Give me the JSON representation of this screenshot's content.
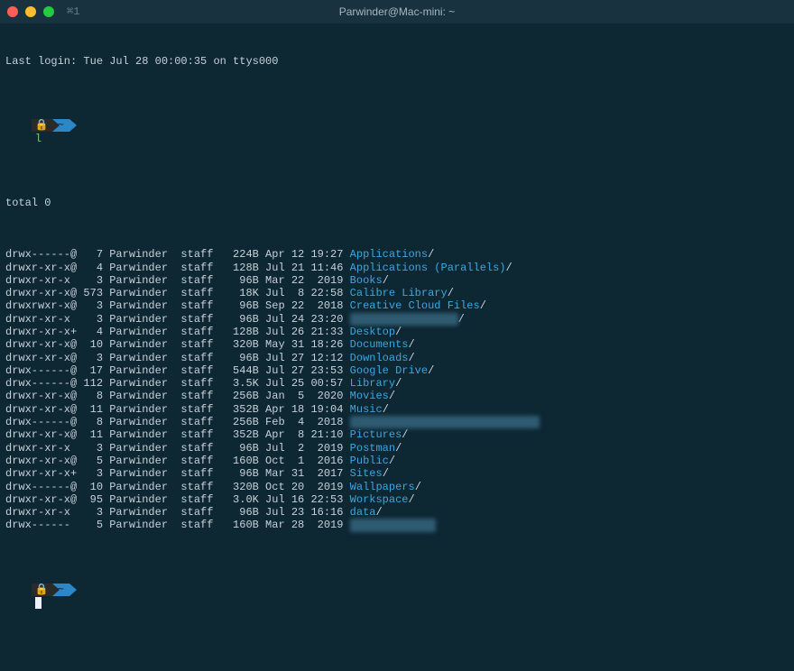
{
  "window": {
    "title": "Parwinder@Mac-mini: ~",
    "shortcut": "⌘1"
  },
  "last_login": "Last login: Tue Jul 28 00:00:35 on ttys000",
  "prompt": {
    "lock_glyph": "",
    "path": "~",
    "command": "l"
  },
  "total_line": "total 0",
  "listing": [
    {
      "perm": "drwx------@",
      "links": "7",
      "owner": "Parwinder",
      "group": "staff",
      "size": "224B",
      "date": "Apr 12 19:27",
      "name": "Applications",
      "suffix": "/",
      "blurred": false
    },
    {
      "perm": "drwxr-xr-x@",
      "links": "4",
      "owner": "Parwinder",
      "group": "staff",
      "size": "128B",
      "date": "Jul 21 11:46",
      "name": "Applications (Parallels)",
      "suffix": "/",
      "blurred": false
    },
    {
      "perm": "drwxr-xr-x ",
      "links": "3",
      "owner": "Parwinder",
      "group": "staff",
      "size": "96B",
      "date": "Mar 22  2019",
      "name": "Books",
      "suffix": "/",
      "blurred": false
    },
    {
      "perm": "drwxr-xr-x@",
      "links": "573",
      "owner": "Parwinder",
      "group": "staff",
      "size": "18K",
      "date": "Jul  8 22:58",
      "name": "Calibre Library",
      "suffix": "/",
      "blurred": false
    },
    {
      "perm": "drwxrwxr-x@",
      "links": "3",
      "owner": "Parwinder",
      "group": "staff",
      "size": "96B",
      "date": "Sep 22  2018",
      "name": "Creative Cloud Files",
      "suffix": "/",
      "blurred": false
    },
    {
      "perm": "drwxr-xr-x ",
      "links": "3",
      "owner": "Parwinder",
      "group": "staff",
      "size": "96B",
      "date": "Jul 24 23:20",
      "name": "",
      "suffix": "/",
      "blurred": true,
      "blurwidth": 120
    },
    {
      "perm": "drwxr-xr-x+",
      "links": "4",
      "owner": "Parwinder",
      "group": "staff",
      "size": "128B",
      "date": "Jul 26 21:33",
      "name": "Desktop",
      "suffix": "/",
      "blurred": false
    },
    {
      "perm": "drwxr-xr-x@",
      "links": "10",
      "owner": "Parwinder",
      "group": "staff",
      "size": "320B",
      "date": "May 31 18:26",
      "name": "Documents",
      "suffix": "/",
      "blurred": false
    },
    {
      "perm": "drwxr-xr-x@",
      "links": "3",
      "owner": "Parwinder",
      "group": "staff",
      "size": "96B",
      "date": "Jul 27 12:12",
      "name": "Downloads",
      "suffix": "/",
      "blurred": false
    },
    {
      "perm": "drwx------@",
      "links": "17",
      "owner": "Parwinder",
      "group": "staff",
      "size": "544B",
      "date": "Jul 27 23:53",
      "name": "Google Drive",
      "suffix": "/",
      "blurred": false
    },
    {
      "perm": "drwx------@",
      "links": "112",
      "owner": "Parwinder",
      "group": "staff",
      "size": "3.5K",
      "date": "Jul 25 00:57",
      "name": "Library",
      "suffix": "/",
      "blurred": false
    },
    {
      "perm": "drwxr-xr-x@",
      "links": "8",
      "owner": "Parwinder",
      "group": "staff",
      "size": "256B",
      "date": "Jan  5  2020",
      "name": "Movies",
      "suffix": "/",
      "blurred": false
    },
    {
      "perm": "drwxr-xr-x@",
      "links": "11",
      "owner": "Parwinder",
      "group": "staff",
      "size": "352B",
      "date": "Apr 18 19:04",
      "name": "Music",
      "suffix": "/",
      "blurred": false
    },
    {
      "perm": "drwx------@",
      "links": "8",
      "owner": "Parwinder",
      "group": "staff",
      "size": "256B",
      "date": "Feb  4  2018",
      "name": "",
      "suffix": "",
      "blurred": true,
      "blurwidth": 210
    },
    {
      "perm": "drwxr-xr-x@",
      "links": "11",
      "owner": "Parwinder",
      "group": "staff",
      "size": "352B",
      "date": "Apr  8 21:10",
      "name": "Pictures",
      "suffix": "/",
      "blurred": false
    },
    {
      "perm": "drwxr-xr-x ",
      "links": "3",
      "owner": "Parwinder",
      "group": "staff",
      "size": "96B",
      "date": "Jul  2  2019",
      "name": "Postman",
      "suffix": "/",
      "blurred": false
    },
    {
      "perm": "drwxr-xr-x@",
      "links": "5",
      "owner": "Parwinder",
      "group": "staff",
      "size": "160B",
      "date": "Oct  1  2016",
      "name": "Public",
      "suffix": "/",
      "blurred": false
    },
    {
      "perm": "drwxr-xr-x+",
      "links": "3",
      "owner": "Parwinder",
      "group": "staff",
      "size": "96B",
      "date": "Mar 31  2017",
      "name": "Sites",
      "suffix": "/",
      "blurred": false
    },
    {
      "perm": "drwx------@",
      "links": "10",
      "owner": "Parwinder",
      "group": "staff",
      "size": "320B",
      "date": "Oct 20  2019",
      "name": "Wallpapers",
      "suffix": "/",
      "blurred": false
    },
    {
      "perm": "drwxr-xr-x@",
      "links": "95",
      "owner": "Parwinder",
      "group": "staff",
      "size": "3.0K",
      "date": "Jul 16 22:53",
      "name": "Workspace",
      "suffix": "/",
      "blurred": false
    },
    {
      "perm": "drwxr-xr-x ",
      "links": "3",
      "owner": "Parwinder",
      "group": "staff",
      "size": "96B",
      "date": "Jul 23 16:16",
      "name": "data",
      "suffix": "/",
      "blurred": false
    },
    {
      "perm": "drwx------ ",
      "links": "5",
      "owner": "Parwinder",
      "group": "staff",
      "size": "160B",
      "date": "Mar 28  2019",
      "name": "",
      "suffix": "",
      "blurred": true,
      "blurwidth": 95
    }
  ]
}
